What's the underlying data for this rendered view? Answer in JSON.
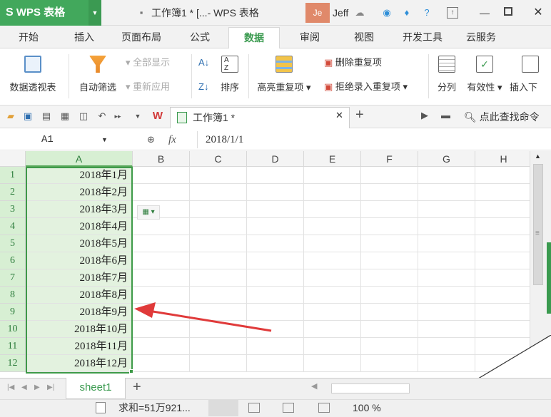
{
  "app": {
    "name": "WPS 表格",
    "title": "工作簿1 * [...- WPS 表格",
    "avatar": "Je",
    "user": "Jeff"
  },
  "menu": {
    "tabs": [
      "开始",
      "插入",
      "页面布局",
      "公式",
      "数据",
      "审阅",
      "视图",
      "开发工具",
      "云服务"
    ],
    "active": "数据"
  },
  "ribbon": {
    "pivot": "数据透视表",
    "autofilter": "自动筛选",
    "show_all": "全部显示",
    "reapply": "重新应用",
    "sort": "排序",
    "highlight_dup": "高亮重复项",
    "remove_dup": "删除重复项",
    "reject_dup": "拒绝录入重复项",
    "split": "分列",
    "validity": "有效性",
    "insert_dropdown": "插入下"
  },
  "doc_tab": {
    "label": "工作簿1 *"
  },
  "find_command": "点此查找命令",
  "formula_bar": {
    "name_box": "A1",
    "fx": "fx",
    "value": "2018/1/1"
  },
  "grid": {
    "columns": [
      "A",
      "B",
      "C",
      "D",
      "E",
      "F",
      "G",
      "H"
    ],
    "rows": [
      {
        "n": "1",
        "a": "2018年1月"
      },
      {
        "n": "2",
        "a": "2018年2月"
      },
      {
        "n": "3",
        "a": "2018年3月"
      },
      {
        "n": "4",
        "a": "2018年4月"
      },
      {
        "n": "5",
        "a": "2018年5月"
      },
      {
        "n": "6",
        "a": "2018年6月"
      },
      {
        "n": "7",
        "a": "2018年7月"
      },
      {
        "n": "8",
        "a": "2018年8月"
      },
      {
        "n": "9",
        "a": "2018年9月"
      },
      {
        "n": "10",
        "a": "2018年10月"
      },
      {
        "n": "11",
        "a": "2018年11月"
      },
      {
        "n": "12",
        "a": "2018年12月"
      }
    ]
  },
  "sheet": {
    "tab": "sheet1",
    "add": "+"
  },
  "status": {
    "sum": "求和=51万921...",
    "zoom": "100 %"
  },
  "colors": {
    "brand": "#42a85c",
    "selection_fill": "#e3f2df",
    "selection_border": "#3e9a48",
    "arrow": "#e03a3a"
  },
  "icons": [
    "wps-logo-icon",
    "window-minimize-icon",
    "window-maximize-icon",
    "window-close-icon",
    "filter-icon",
    "sort-icon",
    "fx-icon",
    "add-sheet-icon",
    "quick-fill-icon",
    "red-arrow-annotation"
  ]
}
